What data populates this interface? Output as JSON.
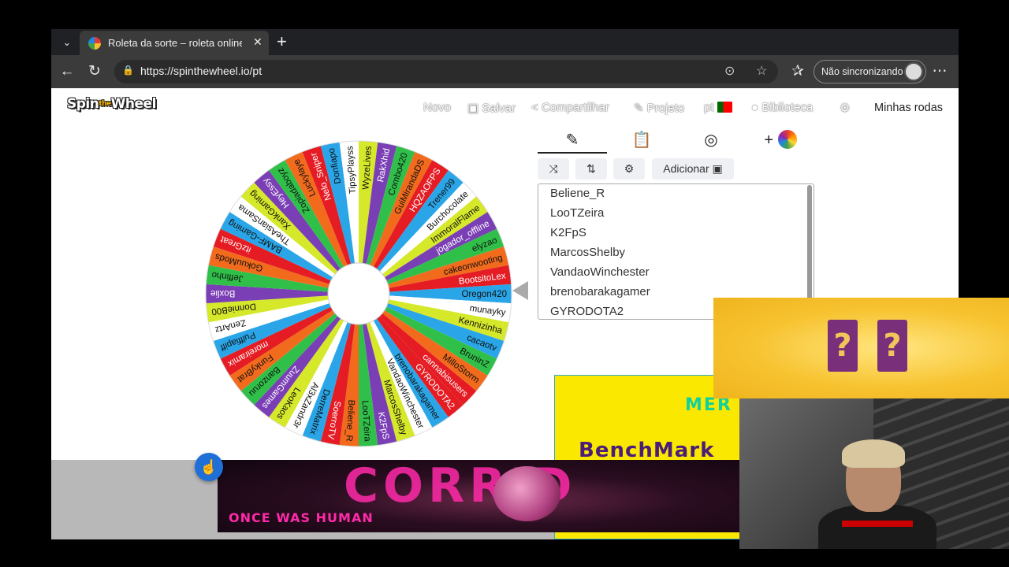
{
  "browser": {
    "tab_title": "Roleta da sorte – roleta online g",
    "close_glyph": "✕",
    "new_tab_glyph": "+",
    "url": "https://spinthewheel.io/pt",
    "sync_label": "Não sincronizando"
  },
  "site": {
    "logo_spin": "Spin",
    "logo_the": "the",
    "logo_wheel": "Wheel",
    "nav": {
      "new": "Novo",
      "save": "Salvar",
      "share": "Compartilhar",
      "project": "Projeto",
      "lang": "pt",
      "library": "Biblioteca",
      "my_wheels": "Minhas rodas"
    },
    "add_button": "Adicionar",
    "entries_visible": [
      "Beliene_R",
      "LooTZeira",
      "K2FpS",
      "MarcosShelby",
      "VandaoWinchester",
      "brenobarakagamer",
      "GYRODOTA2"
    ]
  },
  "wheel": {
    "segments": [
      {
        "label": "Oregon420",
        "color": "#2aa6e8"
      },
      {
        "label": "munayky",
        "color": "#ffffff"
      },
      {
        "label": "Kennizinha",
        "color": "#d6e82a"
      },
      {
        "label": "cacaotv",
        "color": "#2aa6e8"
      },
      {
        "label": "BruninZ",
        "color": "#30c04a"
      },
      {
        "label": "MilloStorm",
        "color": "#f26b1d"
      },
      {
        "label": "cannabisusers",
        "color": "#e51c23"
      },
      {
        "label": "GYRODOTA2",
        "color": "#e51c23"
      },
      {
        "label": "brenobarakagamer",
        "color": "#2aa6e8"
      },
      {
        "label": "VandaoWinchester",
        "color": "#ffffff"
      },
      {
        "label": "MarcosShelby",
        "color": "#d6e82a"
      },
      {
        "label": "K2FpS",
        "color": "#7b3fb5"
      },
      {
        "label": "LooTZeira",
        "color": "#30c04a"
      },
      {
        "label": "Beliene_R",
        "color": "#f26b1d"
      },
      {
        "label": "SoerroTV",
        "color": "#e51c23"
      },
      {
        "label": "DerreMatrix",
        "color": "#2aa6e8"
      },
      {
        "label": "Al3xZandr3r",
        "color": "#ffffff"
      },
      {
        "label": "LeoKaos",
        "color": "#d6e82a"
      },
      {
        "label": "ZuumGames",
        "color": "#7b3fb5"
      },
      {
        "label": "Banzoruu",
        "color": "#30c04a"
      },
      {
        "label": "FunkyBrat",
        "color": "#f26b1d"
      },
      {
        "label": "moreiramix",
        "color": "#e51c23"
      },
      {
        "label": "Pulffiapiff",
        "color": "#2aa6e8"
      },
      {
        "label": "ZenArtz",
        "color": "#ffffff"
      },
      {
        "label": "DonnieB00",
        "color": "#d6e82a"
      },
      {
        "label": "Boxlie",
        "color": "#7b3fb5"
      },
      {
        "label": "Jeffinho",
        "color": "#30c04a"
      },
      {
        "label": "GokuuMods",
        "color": "#f26b1d"
      },
      {
        "label": "itzGreat",
        "color": "#e51c23"
      },
      {
        "label": "BAMF-Gaming",
        "color": "#2aa6e8"
      },
      {
        "label": "TheAsianSama",
        "color": "#ffffff"
      },
      {
        "label": "XankGaming",
        "color": "#d6e82a"
      },
      {
        "label": "HeyEssy",
        "color": "#7b3fb5"
      },
      {
        "label": "Zopiadaboyz",
        "color": "#30c04a"
      },
      {
        "label": "Luckylaye",
        "color": "#f26b1d"
      },
      {
        "label": "Nelo_Sniper",
        "color": "#e51c23"
      },
      {
        "label": "Donfiapo",
        "color": "#2aa6e8"
      },
      {
        "label": "TipsyPlayss",
        "color": "#ffffff"
      },
      {
        "label": "WyzeLives",
        "color": "#d6e82a"
      },
      {
        "label": "RakXhid",
        "color": "#7b3fb5"
      },
      {
        "label": "Combo420",
        "color": "#30c04a"
      },
      {
        "label": "GuiMirandaDS",
        "color": "#f26b1d"
      },
      {
        "label": "HQZAOFPS",
        "color": "#e51c23"
      },
      {
        "label": "Trener99",
        "color": "#2aa6e8"
      },
      {
        "label": "Burchocolate",
        "color": "#ffffff"
      },
      {
        "label": "ImmoralFlame",
        "color": "#d6e82a"
      },
      {
        "label": "jogador_offline",
        "color": "#7b3fb5"
      },
      {
        "label": "elyzao",
        "color": "#30c04a"
      },
      {
        "label": "cakeonwooting",
        "color": "#f26b1d"
      },
      {
        "label": "BootsitoLex",
        "color": "#e51c23"
      }
    ]
  },
  "ads": {
    "banner_title": "CORRID",
    "banner_sub": "ONCE WAS HUMAN",
    "side_top": "MER",
    "side_main": "BenchMark"
  },
  "overlay": {
    "q1": "?",
    "q2": "?"
  }
}
